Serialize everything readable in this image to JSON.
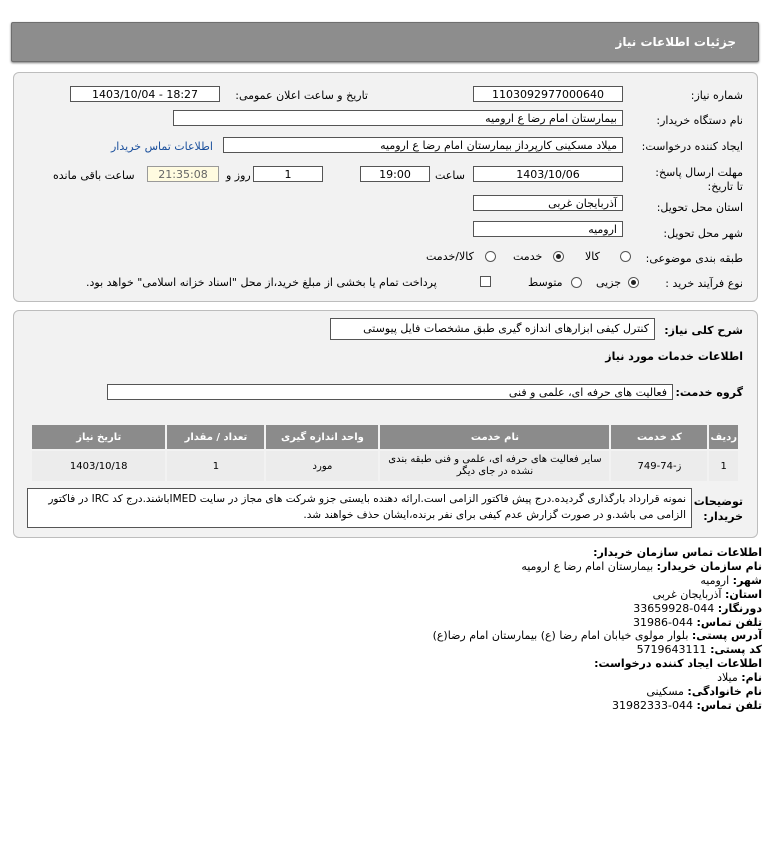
{
  "header": {
    "title": "جزئیات اطلاعات نیاز"
  },
  "form": {
    "need_number_label": "شماره نیاز:",
    "need_number": "1103092977000640",
    "announce_label": "تاریخ و ساعت اعلان عمومی:",
    "announce_value": "1403/10/04 - 18:27",
    "buyer_org_label": "نام دستگاه خریدار:",
    "buyer_org": "بیمارستان امام رضا  ع  ارومیه",
    "creator_label": "ایجاد کننده درخواست:",
    "creator": "میلاد مسکینی کارپرداز بیمارستان امام رضا  ع  ارومیه",
    "contact_link": "اطلاعات تماس خریدار",
    "deadline_label": "مهلت ارسال پاسخ: تا تاریخ:",
    "deadline_date": "1403/10/06",
    "time_label": "ساعت",
    "deadline_time": "19:00",
    "days_value": "1",
    "days_label": "روز و",
    "remaining_time": "21:35:08",
    "remaining_label": "ساعت باقی مانده",
    "province_label": "استان محل تحویل:",
    "province": "آذربایجان غربی",
    "city_label": "شهر محل تحویل:",
    "city": "ارومیه",
    "category_label": "طبقه بندی موضوعی:",
    "category_options": [
      "کالا",
      "خدمت",
      "کالا/خدمت"
    ],
    "category_selected": 1,
    "process_label": "نوع فرآیند خرید :",
    "process_options": [
      "جزیی",
      "متوسط"
    ],
    "process_selected": 0,
    "payment_note": "پرداخت تمام یا بخشی از مبلغ خرید،از محل \"اسناد خزانه اسلامی\" خواهد بود."
  },
  "details": {
    "summary_label": "شرح کلی نیاز:",
    "summary": "کنترل کیفی ابزارهای اندازه گیری طبق مشخصات فایل پیوستی",
    "services_heading": "اطلاعات خدمات مورد نیاز",
    "service_group_label": "گروه خدمت:",
    "service_group": "فعالیت های حرفه ای، علمی و فنی",
    "table": {
      "headers": [
        "ردیف",
        "کد خدمت",
        "نام خدمت",
        "واحد اندازه گیری",
        "تعداد / مقدار",
        "تاریخ نیاز"
      ],
      "rows": [
        [
          "1",
          "ز-74-749",
          "سایر فعالیت های حرفه ای، علمی و فنی طبقه بندی نشده در جای دیگر",
          "مورد",
          "1",
          "1403/10/18"
        ]
      ]
    },
    "notes_label": "توضیحات خریدار:",
    "notes": "نمونه قرارداد بارگذاری گردیده.درج پیش فاکتور الزامی است.ارائه دهنده بایستی جزو شرکت های مجاز در سایت IMEDباشند.درج کد IRC در فاکتور الزامی می باشد.و در صورت گزارش عدم کیفی برای نفر برنده،ایشان حذف خواهند شد."
  },
  "contact": {
    "heading": "اطلاعات تماس سازمان خریدار:",
    "org_label": "نام سازمان خریدار:",
    "org": "بیمارستان امام رضا ع ارومیه",
    "city_label": "شهر:",
    "city": "ارومیه",
    "province_label": "استان:",
    "province": "آذربایجان غربی",
    "fax_label": "دورنگار:",
    "fax": "044-33659928",
    "phone_label": "تلفن تماس:",
    "phone": "044-31986",
    "address_label": "آدرس پستی:",
    "address": "بلوار مولوی خیابان امام رضا (ع) بیمارستان امام رضا(ع)",
    "postal_label": "کد پستی:",
    "postal": "5719643111",
    "creator_heading": "اطلاعات ایجاد کننده درخواست:",
    "first_name_label": "نام:",
    "first_name": "میلاد",
    "last_name_label": "نام خانوادگی:",
    "last_name": "مسکینی",
    "creator_phone_label": "تلفن تماس:",
    "creator_phone": "044-31982333"
  },
  "colors": {
    "header_bg": "#8d8d8d",
    "panel_bg": "#f2f2f2",
    "link": "#1a4f9c",
    "table_header": "#8b8b8b"
  }
}
